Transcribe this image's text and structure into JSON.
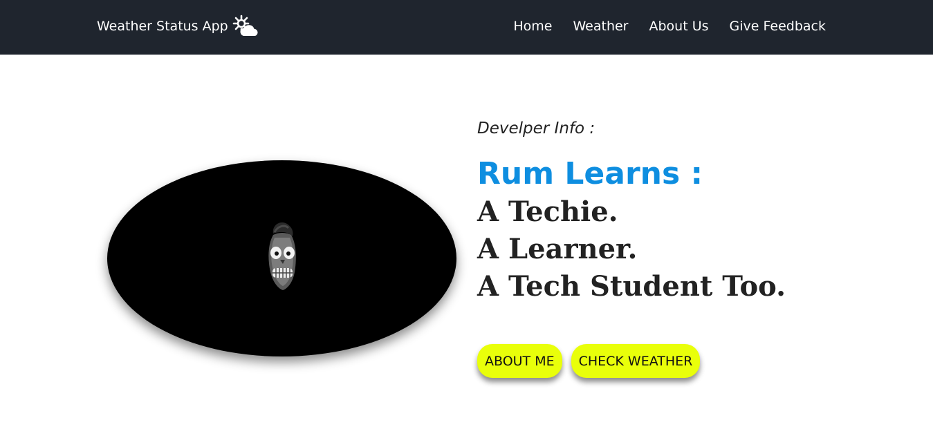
{
  "navbar": {
    "brand": "Weather Status App",
    "brand_icon": "sun-cloud-icon",
    "links": [
      "Home",
      "Weather",
      "About Us",
      "Give Feedback"
    ]
  },
  "developer": {
    "subtitle": "Develper Info :",
    "heading": "Rum Learns :",
    "taglines": [
      "A Techie.",
      "A Learner.",
      "A Tech Student Too."
    ],
    "image_icon": "grinning-skull-avatar"
  },
  "buttons": {
    "about": "ABOUT ME",
    "weather": "CHECK WEATHER"
  },
  "colors": {
    "navbar_bg": "#1f252e",
    "heading": "#0e8ee0",
    "button_bg": "#e9ff0a"
  }
}
